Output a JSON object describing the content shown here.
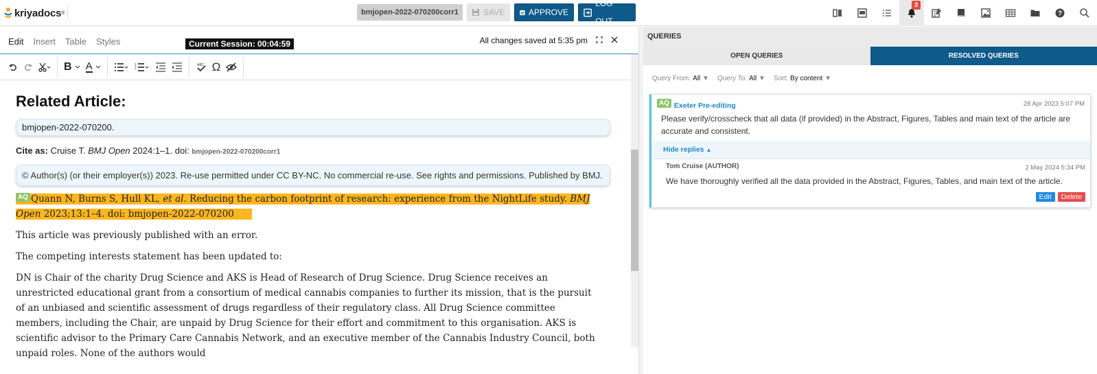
{
  "app": {
    "logo_text": "kriyadocs",
    "logo_mark": "®",
    "doc_id": "bmjopen-2022-070200corr1",
    "save_label": "SAVE",
    "approve_label": "APPROVE",
    "logout_label": "LOG OUT",
    "notification_count": "3",
    "colors": {
      "primary": "#0e5a8a",
      "highlight": "#fdb61d",
      "badge": "#e74c3c",
      "aq_tag": "#8fc36b"
    }
  },
  "right_tools": [
    "compare-icon",
    "preview-icon",
    "list-icon",
    "bell-icon",
    "notes-icon",
    "book-icon",
    "image-icon",
    "table-icon",
    "folder-icon",
    "help-icon",
    "search-icon"
  ],
  "editor": {
    "menu": [
      "Edit",
      "Insert",
      "Table",
      "Styles"
    ],
    "session": "Current Session: 00:04:59",
    "saved": "All changes saved at 5:35 pm",
    "heading": "Related Article:",
    "related_id": "bmjopen-2022-070200.",
    "cite_label": "Cite as:",
    "cite_text_1": " Cruise T. ",
    "cite_journal": "BMJ Open",
    "cite_text_2": " 2024:1–1. doi: ",
    "cite_doi": "bmjopen-2022-070200corr1",
    "copyright": "© Author(s) (or their employer(s)) 2023. Re-use permitted under CC BY-NC. No commercial re-use. See rights and permissions. Published by BMJ.",
    "aq_tag": "AQ",
    "ref_authors": "Quann N, Burns S, Hull KL, ",
    "ref_etal": "et al",
    "ref_title": ". Reducing the carbon footprint of research: experience from the NightLife study. ",
    "ref_journal": "BMJ Open",
    "ref_tail": "2023;13:1–4. doi: bmjopen-2022-070200",
    "p1": "This article was previously published with an error.",
    "p2": "The competing interests statement has been updated to:",
    "p3": "DN is Chair of the charity Drug Science and AKS is Head of Research of Drug Science. Drug Science receives an unrestricted educational grant from a consortium of medical cannabis companies to further its mission, that is the pursuit of an unbiased and scientific assessment of drugs regardless of their regulatory class. All Drug Science committee members, including the Chair, are unpaid by Drug Science for their effort and commitment to this organisation. AKS is scientific advisor to the Primary Care Cannabis Network, and an executive member of the Cannabis Industry Council, both unpaid roles. None of the authors would"
  },
  "queries": {
    "title": "QUERIES",
    "tab_open": "OPEN QUERIES",
    "tab_resolved": "RESOLVED QUERIES",
    "filter_from_label": "Query From:",
    "filter_from_value": "All",
    "filter_to_label": "Query To:",
    "filter_to_value": "All",
    "sort_label": "Sort:",
    "sort_value": "By content",
    "item": {
      "tag": "AQ",
      "source": "Exeter Pre-editing",
      "date": "28 Apr 2023 5:07 PM",
      "text": "Please verify/crosscheck that all data (if provided) in the Abstract, Figures, Tables and main text of the article are accurate and consistent.",
      "hide_replies": "Hide replies",
      "reply_author": "Tom Cruise (AUTHOR)",
      "reply_date": "2 May 2024 5:34 PM",
      "reply_text": "We have thoroughly verified all the data provided in the Abstract, Figures, Tables, and main text of the article.",
      "edit_label": "Edit",
      "delete_label": "Delete"
    }
  }
}
